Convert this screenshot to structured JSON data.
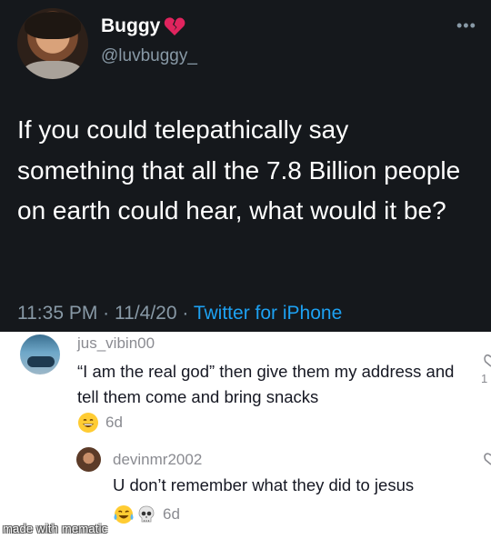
{
  "tweet": {
    "author_name": "Buggy",
    "author_handle": "@luvbuggy_",
    "text": "If you could telepathically say something that all the 7.8 Billion people on earth could hear, what would it be?",
    "time": "11:35 PM",
    "date": "11/4/20",
    "separator": "·",
    "source": "Twitter for iPhone",
    "more_icon": "more-horizontal-icon",
    "name_badge_icon": "broken-heart-icon"
  },
  "comments": [
    {
      "username": "jus_vibin00",
      "text": "“I am the real god” then give them my address and tell them come and bring snacks",
      "reactions": [
        "grinning-face-icon"
      ],
      "time": "6d",
      "like_count": "1"
    },
    {
      "username": "devinmr2002",
      "text": "U don’t remember what they did to jesus",
      "reactions": [
        "tears-of-joy-icon",
        "skull-icon"
      ],
      "time": "6d"
    }
  ],
  "watermark": "made with mematic",
  "colors": {
    "tweet_background": "#15181c",
    "link_blue": "#1da1f2",
    "muted_gray": "#8899a6",
    "comment_text": "#161823"
  }
}
